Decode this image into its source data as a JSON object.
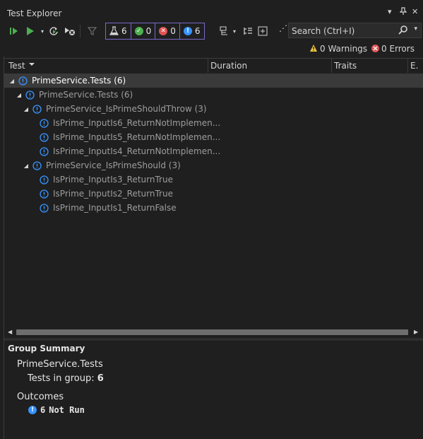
{
  "panel": {
    "title": "Test Explorer",
    "window_buttons": [
      "▾",
      "📌",
      "✕"
    ]
  },
  "toolbar": {
    "counts": {
      "total": "6",
      "passed": "0",
      "failed": "0",
      "not_run": "6"
    },
    "search": {
      "placeholder": "Search (Ctrl+I)"
    }
  },
  "status": {
    "warnings": "0 Warnings",
    "errors": "0 Errors"
  },
  "columns": {
    "test": "Test",
    "duration": "Duration",
    "traits": "Traits",
    "error": "E."
  },
  "tree": [
    {
      "label": "PrimeService.Tests (6)",
      "level": 0,
      "expandable": true,
      "selected": true
    },
    {
      "label": "PrimeService.Tests (6)",
      "level": 1,
      "expandable": true,
      "selected": false
    },
    {
      "label": "PrimeService_IsPrimeShouldThrow (3)",
      "level": 2,
      "expandable": true,
      "selected": false
    },
    {
      "label": "IsPrime_InputIs6_ReturnNotImplemen...",
      "level": 3,
      "expandable": false,
      "selected": false
    },
    {
      "label": "IsPrime_InputIs5_ReturnNotImplemen...",
      "level": 3,
      "expandable": false,
      "selected": false
    },
    {
      "label": "IsPrime_InputIs4_ReturnNotImplemen...",
      "level": 3,
      "expandable": false,
      "selected": false
    },
    {
      "label": "PrimeService_IsPrimeShould (3)",
      "level": 2,
      "expandable": true,
      "selected": false
    },
    {
      "label": "IsPrime_InputIs3_ReturnTrue",
      "level": 3,
      "expandable": false,
      "selected": false
    },
    {
      "label": "IsPrime_InputIs2_ReturnTrue",
      "level": 3,
      "expandable": false,
      "selected": false
    },
    {
      "label": "IsPrime_InputIs1_ReturnFalse",
      "level": 3,
      "expandable": false,
      "selected": false
    }
  ],
  "summary": {
    "heading": "Group Summary",
    "group_name": "PrimeService.Tests",
    "tests_in_group_label": "Tests in group",
    "tests_in_group_value": "6",
    "outcomes_label": "Outcomes",
    "not_run_count": "6",
    "not_run_label": "Not Run"
  },
  "colors": {
    "background": "#1f1f1f",
    "accent_purple": "#7a68c9",
    "info_blue": "#3794ff",
    "pass_green": "#4caf50",
    "fail_red": "#e05252",
    "warning_yellow": "#f0c445"
  }
}
